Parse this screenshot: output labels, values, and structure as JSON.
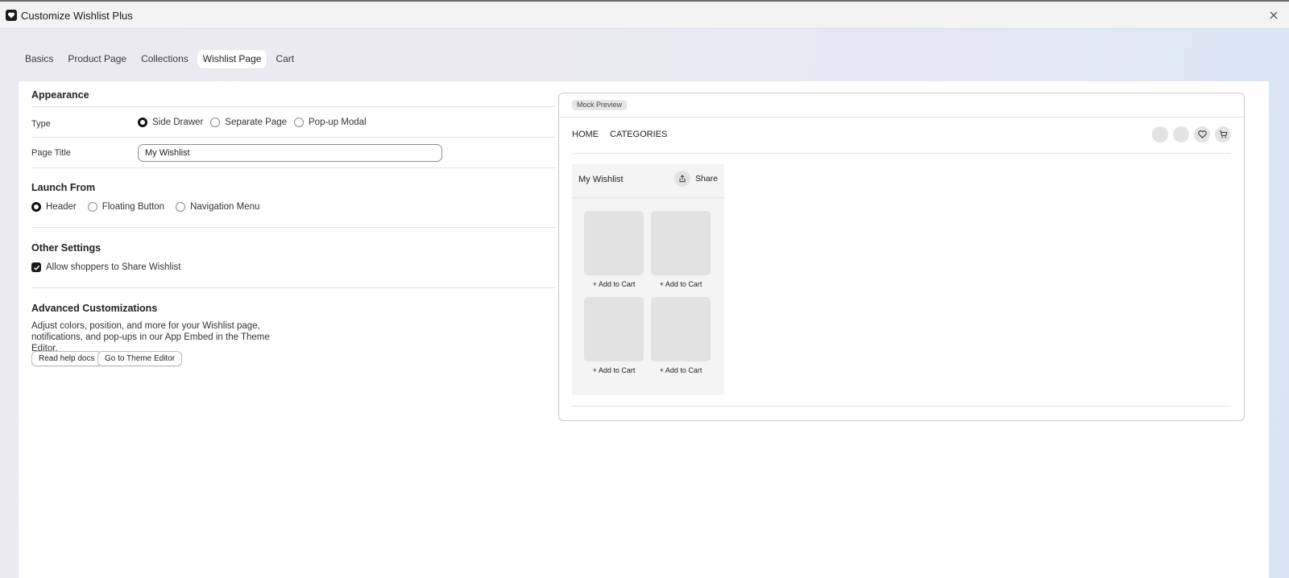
{
  "window": {
    "title": "Customize Wishlist Plus"
  },
  "tabs": [
    {
      "label": "Basics",
      "active": false
    },
    {
      "label": "Product Page",
      "active": false
    },
    {
      "label": "Collections",
      "active": false
    },
    {
      "label": "Wishlist Page",
      "active": true
    },
    {
      "label": "Cart",
      "active": false
    }
  ],
  "appearance": {
    "title": "Appearance",
    "type_label": "Type",
    "type_options": [
      {
        "label": "Side Drawer",
        "checked": true
      },
      {
        "label": "Separate Page",
        "checked": false
      },
      {
        "label": "Pop-up Modal",
        "checked": false
      }
    ],
    "page_title_label": "Page Title",
    "page_title_value": "My Wishlist"
  },
  "launch": {
    "title": "Launch From",
    "options": [
      {
        "label": "Header",
        "checked": true
      },
      {
        "label": "Floating Button",
        "checked": false
      },
      {
        "label": "Navigation Menu",
        "checked": false
      }
    ]
  },
  "other": {
    "title": "Other Settings",
    "share_label": "Allow shoppers to Share Wishlist",
    "share_checked": true
  },
  "advanced": {
    "title": "Advanced Customizations",
    "description": "Adjust colors, position, and more for your Wishlist page, notifications, and pop-ups in our App Embed in the Theme Editor.",
    "help_button": "Read help docs",
    "theme_button": "Go to Theme Editor"
  },
  "preview": {
    "badge": "Mock Preview",
    "nav": [
      "HOME",
      "CATEGORIES"
    ],
    "drawer_title": "My Wishlist",
    "share_label": "Share",
    "items": [
      {
        "button": "+ Add to Cart"
      },
      {
        "button": "+ Add to Cart"
      },
      {
        "button": "+ Add to Cart"
      },
      {
        "button": "+ Add to Cart"
      }
    ],
    "icons": [
      "account-icon",
      "search-icon",
      "heart-icon",
      "cart-icon"
    ]
  }
}
